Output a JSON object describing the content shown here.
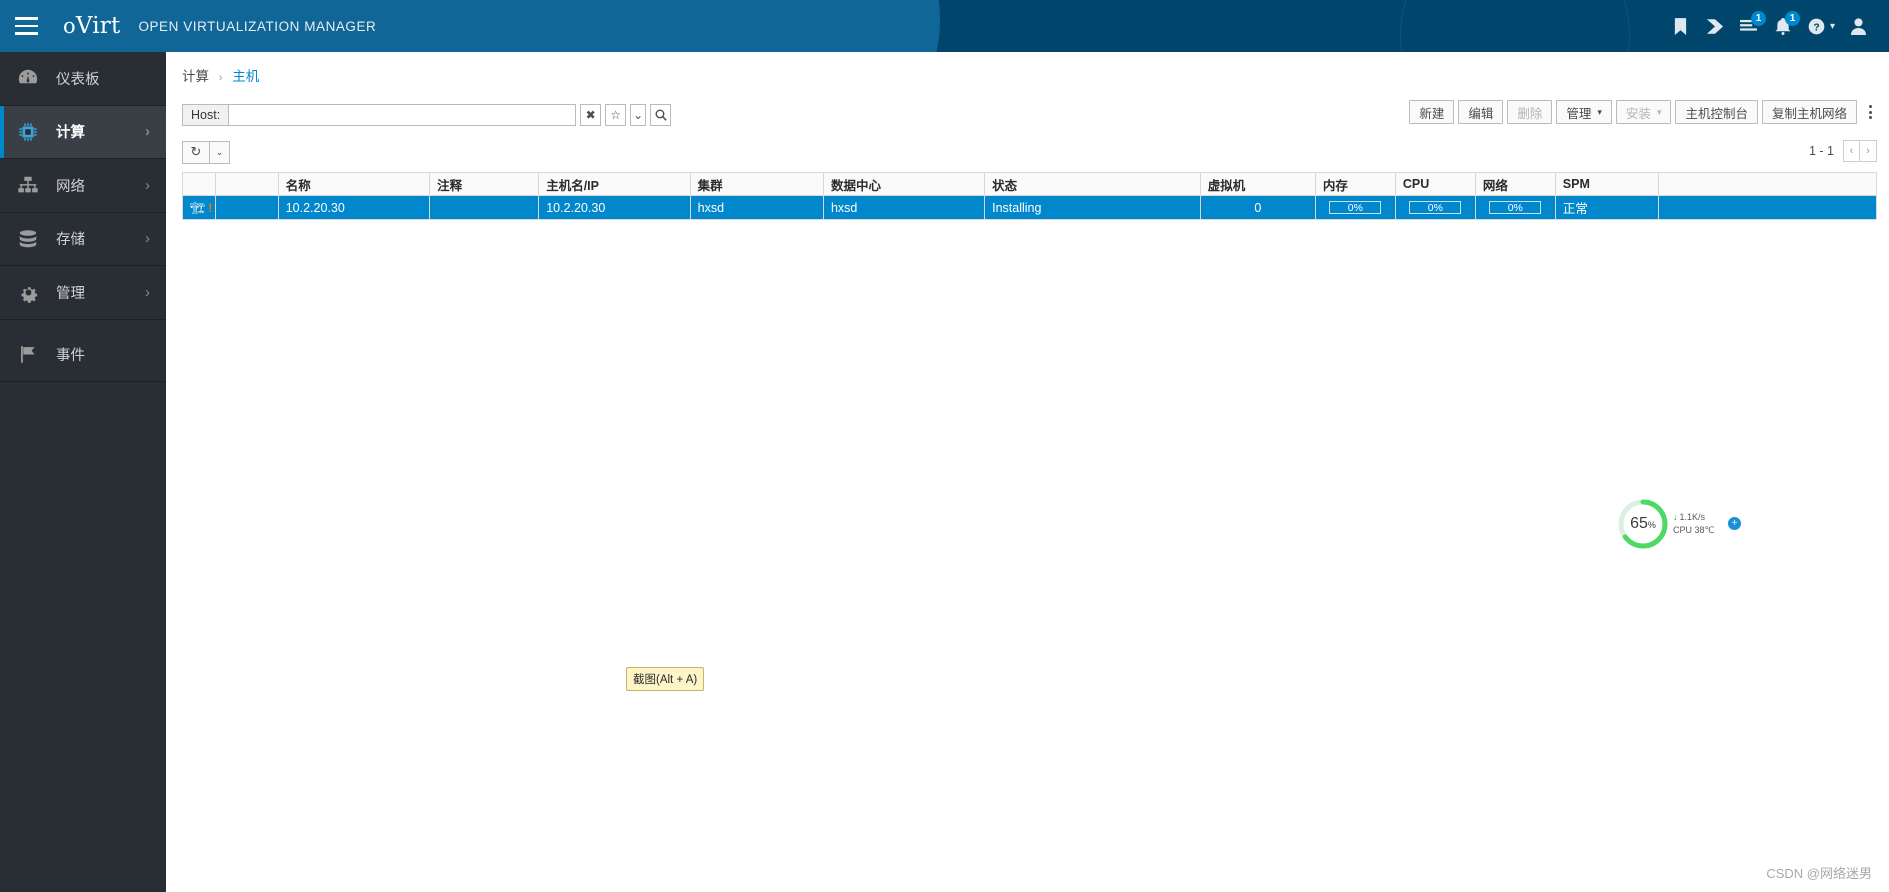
{
  "masthead": {
    "brand_o": "o",
    "brand_virt": "Virt",
    "subtitle": "OPEN VIRTUALIZATION MANAGER",
    "icons": [
      {
        "name": "bookmark-icon",
        "badge": ""
      },
      {
        "name": "tag-icon",
        "badge": ""
      },
      {
        "name": "tasks-icon",
        "badge": "1"
      },
      {
        "name": "bell-icon",
        "badge": "1"
      },
      {
        "name": "help-icon",
        "badge": ""
      },
      {
        "name": "user-icon",
        "badge": ""
      }
    ]
  },
  "sidebar": {
    "items": [
      {
        "label": "仪表板",
        "icon": "dashboard-icon",
        "chevron": "",
        "active": false
      },
      {
        "label": "计算",
        "icon": "compute-icon",
        "chevron": "›",
        "active": true
      },
      {
        "label": "网络",
        "icon": "network-icon",
        "chevron": "›",
        "active": false
      },
      {
        "label": "存储",
        "icon": "storage-icon",
        "chevron": "›",
        "active": false
      },
      {
        "label": "管理",
        "icon": "gear-icon",
        "chevron": "›",
        "active": false
      },
      {
        "label": "事件",
        "icon": "flag-icon",
        "chevron": "",
        "active": false
      }
    ]
  },
  "breadcrumb": {
    "parent": "计算",
    "separator": "›",
    "current": "主机"
  },
  "search": {
    "label": "Host:",
    "value": "",
    "placeholder": "",
    "clear_icon": "✖",
    "star_icon": "☆",
    "caret_icon": "⌄",
    "search_icon": "search-icon"
  },
  "toolbar": {
    "new_label": "新建",
    "edit_label": "编辑",
    "delete_label": "删除",
    "manage_label": "管理",
    "install_label": "安装",
    "console_label": "主机控制台",
    "copy_network_label": "复制主机网络",
    "caret": "⌄"
  },
  "refresh_row": {
    "refresh_icon": "↻",
    "caret": "⌄",
    "pager_text": "1 - 1",
    "prev": "‹",
    "next": "›"
  },
  "table": {
    "headers": [
      "",
      "",
      "名称",
      "注释",
      "主机名/IP",
      "集群",
      "数据中心",
      "状态",
      "虚拟机",
      "内存",
      "CPU",
      "网络",
      "SPM",
      ""
    ],
    "rows": [
      {
        "host_icon": "host-icon",
        "warn_icon": "!",
        "blank": "",
        "name": "10.2.20.30",
        "comment": "",
        "hostname_ip": "10.2.20.30",
        "cluster": "hxsd",
        "datacenter": "hxsd",
        "status": "Installing",
        "vms": "0",
        "memory": "0%",
        "cpu": "0%",
        "network": "0%",
        "spm": "正常",
        "extra": "",
        "selected": true
      }
    ]
  },
  "float_widget": {
    "percent": "65",
    "percent_unit": "%",
    "net_arrow": "↓",
    "net_speed": "1.1K/s",
    "cpu_temp": "CPU 38℃",
    "plus": "+",
    "ring_color": "#4cd964"
  },
  "screenshot_tip": {
    "text": "截图(Alt + A)"
  },
  "watermark": {
    "text": "CSDN @网络迷男"
  }
}
